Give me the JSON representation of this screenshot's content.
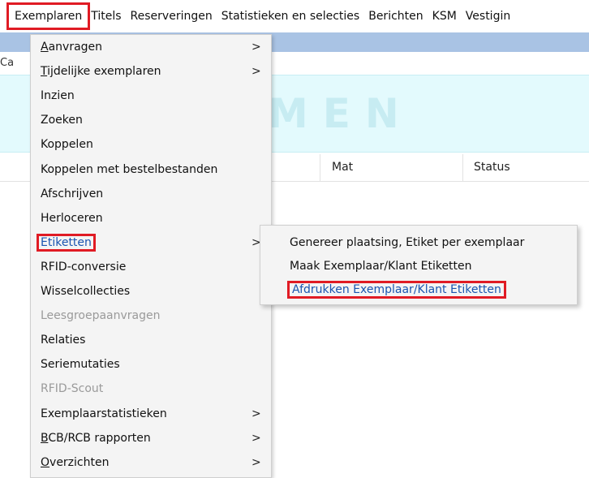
{
  "menubar": {
    "items": [
      "Exemplaren",
      "Titels",
      "Reserveringen",
      "Statistieken en selecties",
      "Berichten",
      "KSM",
      "Vestigin"
    ]
  },
  "background": {
    "left_label": "Ca",
    "banner_text": "MEN",
    "columns": [
      "Mat",
      "Status"
    ]
  },
  "menu": {
    "items": [
      {
        "label": "Aanvragen",
        "underline_first": true,
        "submenu": ">"
      },
      {
        "label": "Tijdelijke exemplaren",
        "underline_first": true,
        "submenu": ">"
      },
      {
        "label": "Inzien"
      },
      {
        "label": "Zoeken"
      },
      {
        "label": "Koppelen"
      },
      {
        "label": "Koppelen met bestelbestanden"
      },
      {
        "label": "Afschrijven"
      },
      {
        "label": "Herloceren"
      },
      {
        "label": "Etiketten",
        "submenu": ">",
        "active": true
      },
      {
        "label": "RFID-conversie"
      },
      {
        "label": "Wisselcollecties"
      },
      {
        "label": "Leesgroepaanvragen",
        "disabled": true
      },
      {
        "label": "Relaties"
      },
      {
        "label": "Seriemutaties"
      },
      {
        "label": "RFID-Scout",
        "disabled": true
      },
      {
        "label": "Exemplaarstatistieken",
        "submenu": ">"
      },
      {
        "label": "BCB/RCB rapporten",
        "underline_first": true,
        "submenu": ">"
      },
      {
        "label": "Overzichten",
        "underline_first": true,
        "submenu": ">"
      }
    ]
  },
  "submenu": {
    "items": [
      {
        "label": "Genereer plaatsing, Etiket per exemplaar"
      },
      {
        "label": "Maak Exemplaar/Klant Etiketten"
      },
      {
        "label": "Afdrukken Exemplaar/Klant Etiketten",
        "active": true
      }
    ]
  },
  "colors": {
    "highlight_box": "#e01b24",
    "active_text": "#1a55b0",
    "menu_bg": "#f4f4f4",
    "banner_bg": "#e3fafd",
    "title_strip": "#a9c3e4"
  }
}
